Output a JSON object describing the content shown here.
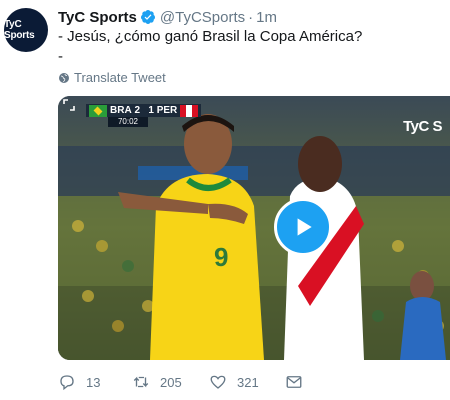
{
  "tweet": {
    "avatar_text": "TyC Sports",
    "name": "TyC Sports",
    "handle": "@TyCSports",
    "separator": "·",
    "time": "1m",
    "text_lines": [
      "- Jesús, ¿cómo ganó Brasil la Copa América?",
      "-"
    ],
    "translate_label": "Translate Tweet"
  },
  "media": {
    "scorebug": {
      "home_team": "BRA",
      "home_score": "2",
      "away_score": "1",
      "away_team": "PER",
      "clock": "70:02"
    },
    "brand_watermark": "TyC S"
  },
  "actions": {
    "replies": "13",
    "retweets": "205",
    "likes": "321"
  },
  "icons": {
    "verified": "verified-badge-icon",
    "globe": "globe-icon",
    "expand": "expand-icon",
    "play": "play-icon",
    "reply": "reply-icon",
    "retweet": "retweet-icon",
    "like": "heart-icon",
    "dm": "envelope-icon"
  },
  "colors": {
    "accent": "#1da1f2",
    "secondary_text": "#657786",
    "primary_text": "#14171a"
  }
}
